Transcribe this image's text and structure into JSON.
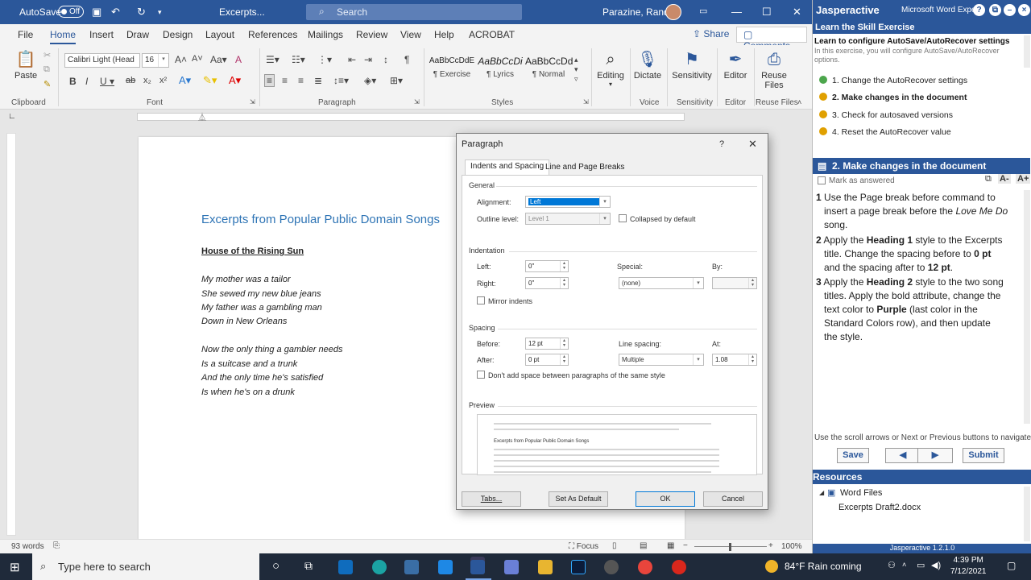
{
  "word": {
    "autosave_label": "AutoSave",
    "autosave_state": "Off",
    "doc_name": "Excerpts...",
    "search_placeholder": "Search",
    "user_name": "Parazine, Randy",
    "tabs": [
      "File",
      "Home",
      "Insert",
      "Draw",
      "Design",
      "Layout",
      "References",
      "Mailings",
      "Review",
      "View",
      "Help",
      "ACROBAT"
    ],
    "share_label": "Share",
    "comments_label": "Comments"
  },
  "ribbon": {
    "paste": "Paste",
    "clipboard": "Clipboard",
    "font_name": "Calibri Light (Head",
    "font_size": "16",
    "font_group": "Font",
    "paragraph_group": "Paragraph",
    "styles_group": "Styles",
    "styles": [
      {
        "sample": "AaBbCcDdE",
        "name": "¶ Exercise"
      },
      {
        "sample": "AaBbCcDi",
        "name": "¶ Lyrics"
      },
      {
        "sample": "AaBbCcDd",
        "name": "¶ Normal"
      }
    ],
    "editing": "Editing",
    "dictate": "Dictate",
    "voice": "Voice",
    "sensitivity": "Sensitivity",
    "editor": "Editor",
    "reuse_files_1": "Reuse",
    "reuse_files_2": "Files",
    "reuse_group": "Reuse Files"
  },
  "document": {
    "title": "Excerpts from Popular Public Domain Songs",
    "song_title": "House of the Rising Sun",
    "lines_1": [
      "My mother was a tailor",
      "She sewed my new blue jeans",
      "My father was a gambling man",
      "Down in New Orleans"
    ],
    "lines_2": [
      "Now the only thing a gambler needs",
      "Is a suitcase and a trunk",
      "And the only time he's satisfied",
      "Is when he's on a drunk"
    ]
  },
  "statusbar": {
    "words": "93 words",
    "focus": "Focus",
    "zoom": "100%"
  },
  "dialog": {
    "title": "Paragraph",
    "help": "?",
    "tab_1": "Indents and Spacing",
    "tab_2": "Line and Page Breaks",
    "general": "General",
    "alignment_label": "Alignment:",
    "alignment_value": "Left",
    "outline_label": "Outline level:",
    "outline_value": "Level 1",
    "collapsed_label": "Collapsed by default",
    "indentation": "Indentation",
    "left_label": "Left:",
    "left_value": "0\"",
    "right_label": "Right:",
    "right_value": "0\"",
    "special_label": "Special:",
    "special_value": "(none)",
    "by_label": "By:",
    "mirror_label": "Mirror indents",
    "spacing": "Spacing",
    "before_label": "Before:",
    "before_value": "12 pt",
    "after_label": "After:",
    "after_value": "0 pt",
    "line_spacing_label": "Line spacing:",
    "line_spacing_value": "Multiple",
    "at_label": "At:",
    "at_value": "1.08",
    "dont_add_label": "Don't add space between paragraphs of the same style",
    "preview": "Preview",
    "preview_sample": "Excerpts from Popular Public Domain Songs",
    "tabs_btn": "Tabs...",
    "default_btn": "Set As Default",
    "ok_btn": "OK",
    "cancel_btn": "Cancel"
  },
  "jasper": {
    "brand": "Jasperactive",
    "window_title": "Microsoft Word Exper",
    "section_link": "Learn the Skill Exercise",
    "subtitle": "Learn to configure AutoSave/AutoRecover settings",
    "desc": "In this exercise, you will configure AutoSave/AutoRecover options.",
    "steps": [
      "1. Change the AutoRecover settings",
      "2. Make changes in the document",
      "3. Check for autosaved versions",
      "4. Reset the AutoRecover value"
    ],
    "step_header": "2. Make changes in the document",
    "mark_answered": "Mark as answered",
    "nav_hint": "Use the scroll arrows or Next or Previous buttons to navigate.",
    "save_btn": "Save",
    "submit_btn": "Submit",
    "resources": "Resources",
    "word_files": "Word Files",
    "file_name": "Excerpts Draft2.docx",
    "version": "Jasperactive 1.2.1.0"
  },
  "taskbar": {
    "search_placeholder": "Type here to search",
    "weather": "84°F  Rain coming",
    "time": "4:39 PM",
    "date": "7/12/2021"
  }
}
